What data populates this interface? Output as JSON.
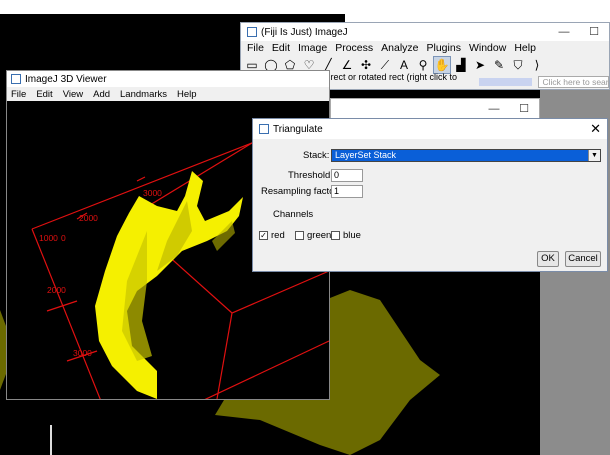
{
  "fiji": {
    "title": "(Fiji Is Just) ImageJ",
    "menu": [
      "File",
      "Edit",
      "Image",
      "Process",
      "Analyze",
      "Plugins",
      "Window",
      "Help"
    ],
    "tools": [
      {
        "name": "rectangle-tool-icon",
        "glyph": "▭"
      },
      {
        "name": "oval-tool-icon",
        "glyph": "◯"
      },
      {
        "name": "polygon-tool-icon",
        "glyph": "⬠"
      },
      {
        "name": "freehand-tool-icon",
        "glyph": "♡"
      },
      {
        "name": "line-tool-icon",
        "glyph": "╱"
      },
      {
        "name": "angle-tool-icon",
        "glyph": "∠"
      },
      {
        "name": "point-tool-icon",
        "glyph": "✣"
      },
      {
        "name": "wand-tool-icon",
        "glyph": "⟋"
      },
      {
        "name": "text-tool-icon",
        "glyph": "A"
      },
      {
        "name": "magnifier-tool-icon",
        "glyph": "⚲"
      },
      {
        "name": "hand-tool-icon",
        "glyph": "✋"
      },
      {
        "name": "dropper-tool-icon",
        "glyph": "▟"
      },
      {
        "name": "arrow-tool-icon",
        "glyph": "➤"
      },
      {
        "name": "pencil-tool-icon",
        "glyph": "✎"
      },
      {
        "name": "bucket-tool-icon",
        "glyph": "⛉"
      },
      {
        "name": "more-tools-icon",
        "glyph": "⟩"
      }
    ],
    "status": "\"Rectangle\", rounded rect or rotated rect (right click to switch)",
    "search_placeholder": "Click here to search"
  },
  "viewer": {
    "title": "ImageJ 3D Viewer",
    "menu": [
      "File",
      "Edit",
      "View",
      "Add",
      "Landmarks",
      "Help"
    ],
    "axis_labels": [
      "3000",
      "2000",
      "1000",
      "0",
      "2000",
      "3000"
    ]
  },
  "dialog": {
    "title": "Triangulate",
    "stack_label": "Stack:",
    "stack_value": "LayerSet Stack",
    "threshold_label": "Threshold",
    "threshold_value": "0",
    "resampling_label": "Resampling factor",
    "resampling_value": "1",
    "channels_label": "Channels",
    "channels": [
      {
        "label": "red",
        "checked": true
      },
      {
        "label": "green",
        "checked": false
      },
      {
        "label": "blue",
        "checked": false
      }
    ],
    "ok_label": "OK",
    "cancel_label": "Cancel"
  },
  "colors": {
    "mesh": "#f5f000",
    "bbox": "#e01010",
    "bg_shape": "#6b6a00",
    "select": "#0a5fd8"
  }
}
